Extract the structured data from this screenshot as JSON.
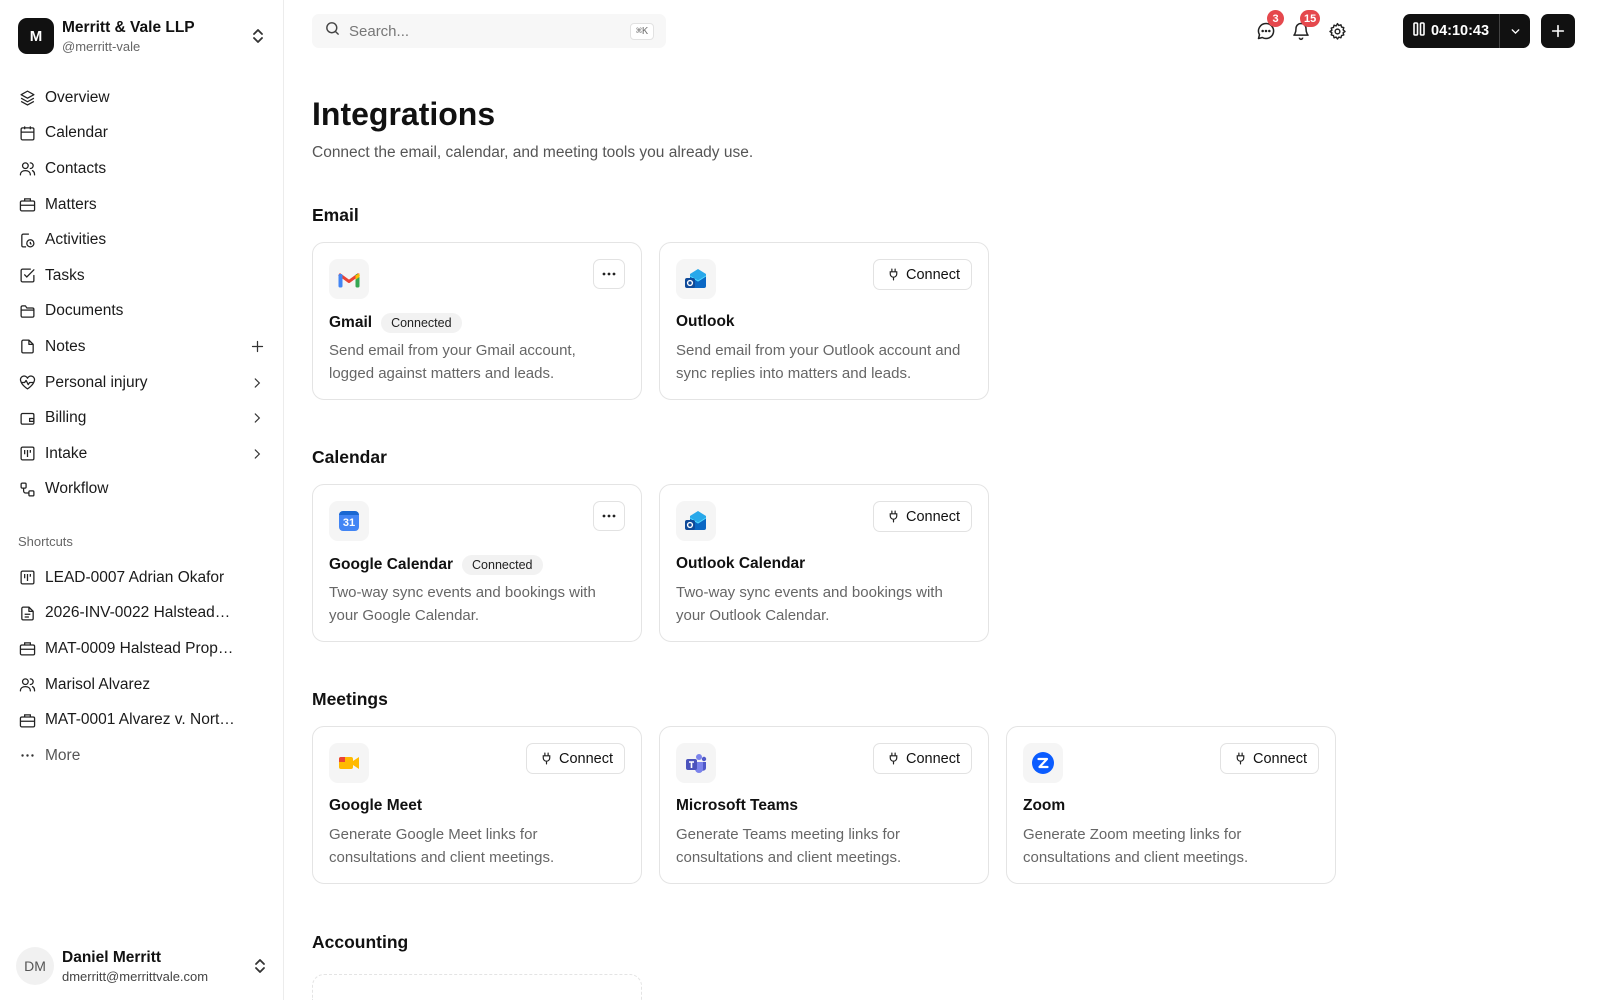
{
  "workspace": {
    "initial": "M",
    "name": "Merritt & Vale LLP",
    "handle": "@merritt-vale"
  },
  "nav": [
    {
      "label": "Overview",
      "icon": "layers-icon"
    },
    {
      "label": "Calendar",
      "icon": "calendar-icon"
    },
    {
      "label": "Contacts",
      "icon": "users-icon"
    },
    {
      "label": "Matters",
      "icon": "briefcase-icon"
    },
    {
      "label": "Activities",
      "icon": "clock-document-icon"
    },
    {
      "label": "Tasks",
      "icon": "checkbox-icon"
    },
    {
      "label": "Documents",
      "icon": "folder-icon"
    },
    {
      "label": "Notes",
      "icon": "note-icon",
      "trail": "plus-icon"
    },
    {
      "label": "Personal injury",
      "icon": "heart-pulse-icon",
      "trail": "chevron-right-icon"
    },
    {
      "label": "Billing",
      "icon": "wallet-icon",
      "trail": "chevron-right-icon"
    },
    {
      "label": "Intake",
      "icon": "kanban-icon",
      "trail": "chevron-right-icon"
    },
    {
      "label": "Workflow",
      "icon": "workflow-icon"
    }
  ],
  "shortcuts": {
    "title": "Shortcuts",
    "items": [
      {
        "label": "LEAD-0007 Adrian Okafor",
        "icon": "kanban-icon"
      },
      {
        "label": "2026-INV-0022 Halstead…",
        "icon": "invoice-icon"
      },
      {
        "label": "MAT-0009 Halstead Prop…",
        "icon": "briefcase-icon"
      },
      {
        "label": "Marisol Alvarez",
        "icon": "user-icon"
      },
      {
        "label": "MAT-0001 Alvarez v. Nort…",
        "icon": "briefcase-icon"
      }
    ],
    "more_label": "More"
  },
  "user": {
    "initials": "DM",
    "name": "Daniel Merritt",
    "email": "dmerritt@merrittvale.com"
  },
  "topbar": {
    "search_placeholder": "Search...",
    "search_shortcut": "⌘K",
    "messages_count": "3",
    "notifications_count": "15",
    "timer": "04:10:43"
  },
  "page": {
    "title": "Integrations",
    "subtitle": "Connect the email, calendar, and meeting tools you already use."
  },
  "labels": {
    "connected": "Connected",
    "connect": "Connect"
  },
  "sections": {
    "email": {
      "title": "Email",
      "cards": [
        {
          "name": "Gmail",
          "logo": "gmail-logo-icon",
          "status": "Connected",
          "desc": "Send email from your Gmail account, logged against matters and leads."
        },
        {
          "name": "Outlook",
          "logo": "outlook-logo-icon",
          "action": "Connect",
          "desc": "Send email from your Outlook account and sync replies into matters and leads."
        }
      ]
    },
    "calendar": {
      "title": "Calendar",
      "cards": [
        {
          "name": "Google Calendar",
          "logo": "google-calendar-logo-icon",
          "logo_text": "31",
          "status": "Connected",
          "desc": "Two-way sync events and bookings with your Google Calendar."
        },
        {
          "name": "Outlook Calendar",
          "logo": "outlook-logo-icon",
          "action": "Connect",
          "desc": "Two-way sync events and bookings with your Outlook Calendar."
        }
      ]
    },
    "meetings": {
      "title": "Meetings",
      "cards": [
        {
          "name": "Google Meet",
          "logo": "google-meet-logo-icon",
          "action": "Connect",
          "desc": "Generate Google Meet links for consultations and client meetings."
        },
        {
          "name": "Microsoft Teams",
          "logo": "teams-logo-icon",
          "action": "Connect",
          "desc": "Generate Teams meeting links for consultations and client meetings."
        },
        {
          "name": "Zoom",
          "logo": "zoom-logo-icon",
          "action": "Connect",
          "desc": "Generate Zoom meeting links for consultations and client meetings."
        }
      ]
    },
    "accounting": {
      "title": "Accounting"
    }
  },
  "colors": {
    "primary": "#111111",
    "badge": "#e5484d",
    "muted_text": "#666666",
    "border": "#e4e4e4"
  }
}
